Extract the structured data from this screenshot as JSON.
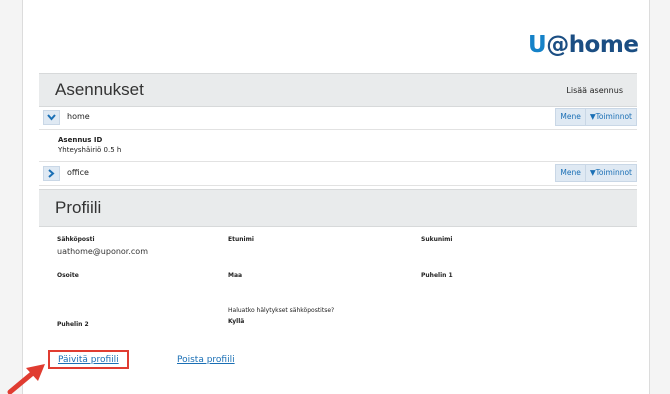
{
  "brand": {
    "logo_u": "U",
    "logo_rest": "@home"
  },
  "installations": {
    "title": "Asennukset",
    "add_label": "Lisää asennus",
    "items": [
      {
        "name": "home",
        "go": "Mene",
        "actions": "▼Toiminnot"
      },
      {
        "name": "office",
        "go": "Mene",
        "actions": "▼Toiminnot"
      }
    ],
    "detail": {
      "label": "Asennus ID",
      "status": "Yhteyshäiriö 0.5 h"
    }
  },
  "profile": {
    "title": "Profiili",
    "email_label": "Sähköposti",
    "email_value": "uathome@uponor.com",
    "firstname_label": "Etunimi",
    "lastname_label": "Sukunimi",
    "address_label": "Osoite",
    "country_label": "Maa",
    "phone1_label": "Puhelin 1",
    "alerts_label": "Haluatko hälytykset sähköpostitse?",
    "alerts_value": "Kyllä",
    "phone2_label": "Puhelin 2",
    "update_link": "Päivitä profiili",
    "delete_link": "Poista profiili"
  },
  "colors": {
    "accent": "#1a6fb5",
    "highlight": "#e03c31",
    "logo": "#1b4e83"
  }
}
